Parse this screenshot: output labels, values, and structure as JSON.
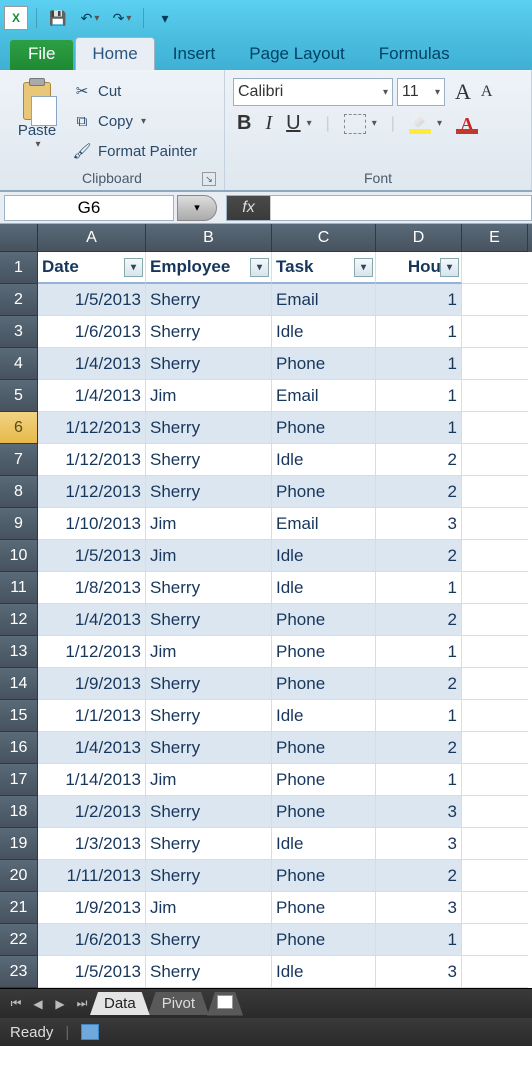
{
  "qat": {
    "save": "💾",
    "undo": "↶",
    "redo": "↷"
  },
  "tabs": {
    "file": "File",
    "home": "Home",
    "insert": "Insert",
    "page_layout": "Page Layout",
    "formulas": "Formulas"
  },
  "ribbon": {
    "clipboard": {
      "paste": "Paste",
      "cut": "Cut",
      "copy": "Copy",
      "format_painter": "Format Painter",
      "group_label": "Clipboard"
    },
    "font": {
      "name": "Calibri",
      "size": "11",
      "group_label": "Font"
    }
  },
  "name_box": "G6",
  "fx_label": "fx",
  "formula_value": "",
  "columns": [
    "A",
    "B",
    "C",
    "D",
    "E"
  ],
  "headers": {
    "date": "Date",
    "employee": "Employee",
    "task": "Task",
    "hours": "Hours"
  },
  "selected_row_index": 6,
  "rows": [
    {
      "n": 1,
      "date": "",
      "employee": "",
      "task": "",
      "hours": "",
      "is_header": true
    },
    {
      "n": 2,
      "date": "1/5/2013",
      "employee": "Sherry",
      "task": "Email",
      "hours": "1"
    },
    {
      "n": 3,
      "date": "1/6/2013",
      "employee": "Sherry",
      "task": "Idle",
      "hours": "1"
    },
    {
      "n": 4,
      "date": "1/4/2013",
      "employee": "Sherry",
      "task": "Phone",
      "hours": "1"
    },
    {
      "n": 5,
      "date": "1/4/2013",
      "employee": "Jim",
      "task": "Email",
      "hours": "1"
    },
    {
      "n": 6,
      "date": "1/12/2013",
      "employee": "Sherry",
      "task": "Phone",
      "hours": "1"
    },
    {
      "n": 7,
      "date": "1/12/2013",
      "employee": "Sherry",
      "task": "Idle",
      "hours": "2"
    },
    {
      "n": 8,
      "date": "1/12/2013",
      "employee": "Sherry",
      "task": "Phone",
      "hours": "2"
    },
    {
      "n": 9,
      "date": "1/10/2013",
      "employee": "Jim",
      "task": "Email",
      "hours": "3"
    },
    {
      "n": 10,
      "date": "1/5/2013",
      "employee": "Jim",
      "task": "Idle",
      "hours": "2"
    },
    {
      "n": 11,
      "date": "1/8/2013",
      "employee": "Sherry",
      "task": "Idle",
      "hours": "1"
    },
    {
      "n": 12,
      "date": "1/4/2013",
      "employee": "Sherry",
      "task": "Phone",
      "hours": "2"
    },
    {
      "n": 13,
      "date": "1/12/2013",
      "employee": "Jim",
      "task": "Phone",
      "hours": "1"
    },
    {
      "n": 14,
      "date": "1/9/2013",
      "employee": "Sherry",
      "task": "Phone",
      "hours": "2"
    },
    {
      "n": 15,
      "date": "1/1/2013",
      "employee": "Sherry",
      "task": "Idle",
      "hours": "1"
    },
    {
      "n": 16,
      "date": "1/4/2013",
      "employee": "Sherry",
      "task": "Phone",
      "hours": "2"
    },
    {
      "n": 17,
      "date": "1/14/2013",
      "employee": "Jim",
      "task": "Phone",
      "hours": "1"
    },
    {
      "n": 18,
      "date": "1/2/2013",
      "employee": "Sherry",
      "task": "Phone",
      "hours": "3"
    },
    {
      "n": 19,
      "date": "1/3/2013",
      "employee": "Sherry",
      "task": "Idle",
      "hours": "3"
    },
    {
      "n": 20,
      "date": "1/11/2013",
      "employee": "Sherry",
      "task": "Phone",
      "hours": "2"
    },
    {
      "n": 21,
      "date": "1/9/2013",
      "employee": "Jim",
      "task": "Phone",
      "hours": "3"
    },
    {
      "n": 22,
      "date": "1/6/2013",
      "employee": "Sherry",
      "task": "Phone",
      "hours": "1"
    },
    {
      "n": 23,
      "date": "1/5/2013",
      "employee": "Sherry",
      "task": "Idle",
      "hours": "3"
    }
  ],
  "chart_data": {
    "type": "table",
    "columns": [
      "Date",
      "Employee",
      "Task",
      "Hours"
    ],
    "rows": [
      [
        "1/5/2013",
        "Sherry",
        "Email",
        1
      ],
      [
        "1/6/2013",
        "Sherry",
        "Idle",
        1
      ],
      [
        "1/4/2013",
        "Sherry",
        "Phone",
        1
      ],
      [
        "1/4/2013",
        "Jim",
        "Email",
        1
      ],
      [
        "1/12/2013",
        "Sherry",
        "Phone",
        1
      ],
      [
        "1/12/2013",
        "Sherry",
        "Idle",
        2
      ],
      [
        "1/12/2013",
        "Sherry",
        "Phone",
        2
      ],
      [
        "1/10/2013",
        "Jim",
        "Email",
        3
      ],
      [
        "1/5/2013",
        "Jim",
        "Idle",
        2
      ],
      [
        "1/8/2013",
        "Sherry",
        "Idle",
        1
      ],
      [
        "1/4/2013",
        "Sherry",
        "Phone",
        2
      ],
      [
        "1/12/2013",
        "Jim",
        "Phone",
        1
      ],
      [
        "1/9/2013",
        "Sherry",
        "Phone",
        2
      ],
      [
        "1/1/2013",
        "Sherry",
        "Idle",
        1
      ],
      [
        "1/4/2013",
        "Sherry",
        "Phone",
        2
      ],
      [
        "1/14/2013",
        "Jim",
        "Phone",
        1
      ],
      [
        "1/2/2013",
        "Sherry",
        "Phone",
        3
      ],
      [
        "1/3/2013",
        "Sherry",
        "Idle",
        3
      ],
      [
        "1/11/2013",
        "Sherry",
        "Phone",
        2
      ],
      [
        "1/9/2013",
        "Jim",
        "Phone",
        3
      ],
      [
        "1/6/2013",
        "Sherry",
        "Phone",
        1
      ],
      [
        "1/5/2013",
        "Sherry",
        "Idle",
        3
      ]
    ]
  },
  "sheets": {
    "active": "Data",
    "others": [
      "Pivot"
    ]
  },
  "status": "Ready"
}
